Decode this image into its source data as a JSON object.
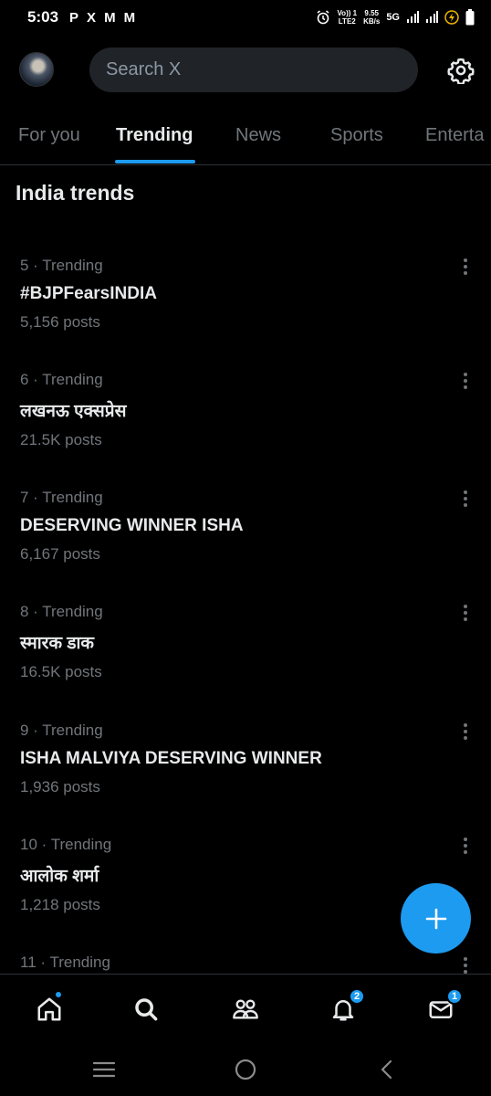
{
  "status_bar": {
    "time": "5:03",
    "apps": [
      "P",
      "X",
      "M",
      "M"
    ],
    "volte_line1": "Vo)) 1",
    "volte_line2": "LTE2",
    "speed_value": "9.55",
    "speed_unit": "KB/s",
    "network": "5G"
  },
  "header": {
    "search_placeholder": "Search X"
  },
  "tabs": [
    {
      "label": "For you"
    },
    {
      "label": "Trending"
    },
    {
      "label": "News"
    },
    {
      "label": "Sports"
    },
    {
      "label": "Enterta"
    }
  ],
  "section_title": "India trends",
  "trends": [
    {
      "meta": "5 · Trending",
      "name": "#BJPFearsINDIA",
      "count": "5,156 posts"
    },
    {
      "meta": "6 · Trending",
      "name": "लखनऊ एक्सप्रेस",
      "count": "21.5K posts"
    },
    {
      "meta": "7 · Trending",
      "name": "DESERVING WINNER ISHA",
      "count": "6,167 posts"
    },
    {
      "meta": "8 · Trending",
      "name": "स्मारक डाक",
      "count": "16.5K posts"
    },
    {
      "meta": "9 · Trending",
      "name": "ISHA MALVIYA DESERVING WINNER",
      "count": "1,936 posts"
    },
    {
      "meta": "10 · Trending",
      "name": "आलोक शर्मा",
      "count": "1,218 posts"
    },
    {
      "meta": "11 · Trending",
      "name": "",
      "count": ""
    }
  ],
  "bottom_nav": {
    "notifications_badge": "2",
    "messages_badge": "1"
  },
  "colors": {
    "accent": "#1d9bf0",
    "background": "#000000",
    "muted_text": "#71767b",
    "primary_text": "#e7e9ea"
  }
}
